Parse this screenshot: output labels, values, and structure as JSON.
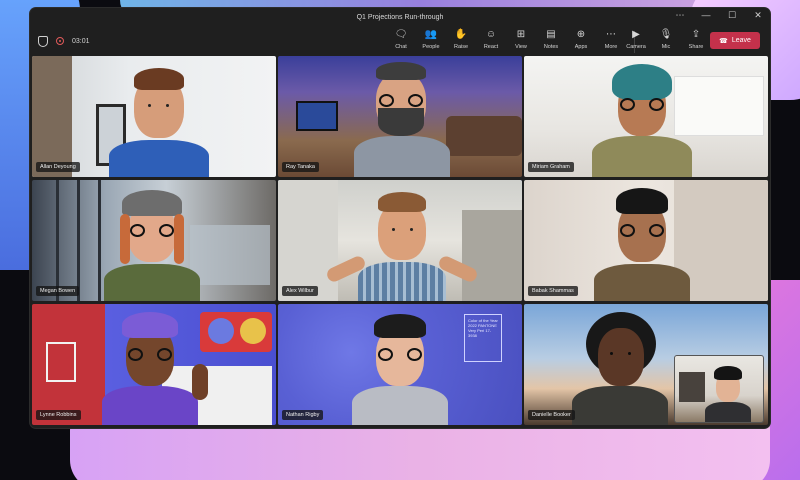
{
  "window": {
    "title": "Q1 Projections Run-through",
    "controls": [
      "⋯",
      "—",
      "☐",
      "✕"
    ]
  },
  "toolbar": {
    "timer": "03:01",
    "actions": [
      {
        "label": "Chat",
        "icon": "chat-icon"
      },
      {
        "label": "People",
        "icon": "people-icon"
      },
      {
        "label": "Raise",
        "icon": "hand-icon"
      },
      {
        "label": "React",
        "icon": "smile-icon"
      },
      {
        "label": "View",
        "icon": "grid-view-icon"
      },
      {
        "label": "Notes",
        "icon": "notes-icon"
      },
      {
        "label": "Apps",
        "icon": "apps-icon"
      },
      {
        "label": "More",
        "icon": "more-icon"
      }
    ],
    "devices": [
      {
        "label": "Camera",
        "icon": "camera-icon"
      },
      {
        "label": "Mic",
        "icon": "mic-icon"
      },
      {
        "label": "Share",
        "icon": "share-icon"
      }
    ],
    "leave_label": "Leave"
  },
  "participants": [
    {
      "name": "Allan Deyoung"
    },
    {
      "name": "Ray Tanaka"
    },
    {
      "name": "Miriam Graham"
    },
    {
      "name": "Megan Bowen"
    },
    {
      "name": "Alex Wilbur"
    },
    {
      "name": "Babak Shammas"
    },
    {
      "name": "Lynne Robbins"
    },
    {
      "name": "Nathan Rigby"
    },
    {
      "name": "Danielle Booker"
    }
  ],
  "pantone_card": "Color of the Year 2022 PANTONE Very Peri 17-3938",
  "colors": {
    "leave": "#c4314b",
    "active_border": "#8f8ff0"
  }
}
